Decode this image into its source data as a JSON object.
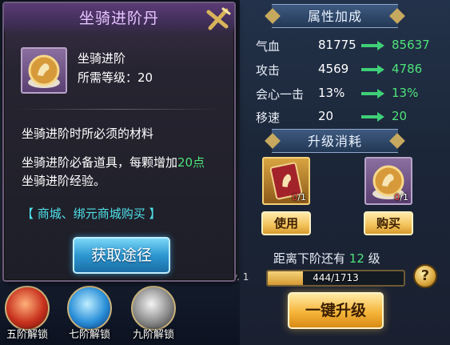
{
  "tooltip": {
    "title": "坐骑进阶丹",
    "item_name": "坐骑进阶",
    "level_req": "所需等级：20",
    "desc_line1": "坐骑进阶时所必须的材料",
    "desc_line2_pre": "坐骑进阶必备道具，每颗增加",
    "desc_line2_hl": "20点",
    "desc_line3": "坐骑进阶经验。",
    "source_links": "【 商城、绑元商城购买 】",
    "get_button": "获取途径"
  },
  "attributes": {
    "header": "属性加成",
    "rows": [
      {
        "name": "气血",
        "current": "81775",
        "next": "85637"
      },
      {
        "name": "攻击",
        "current": "4569",
        "next": "4786"
      },
      {
        "name": "会心一击",
        "current": "13%",
        "next": "13%"
      },
      {
        "name": "移速",
        "current": "20",
        "next": "20"
      }
    ]
  },
  "cost": {
    "header": "升级消耗",
    "items": [
      {
        "have": "0",
        "need": "1",
        "button": "使用"
      },
      {
        "have": "0",
        "need": "1",
        "button": "购买"
      }
    ]
  },
  "progress": {
    "prefix": "距离下阶还有",
    "remaining": "12",
    "suffix": "级",
    "level_tag": "v. 1",
    "exp_text": "444/1713",
    "exp_current": 444,
    "exp_max": 1713
  },
  "upgrade_button": "一键升级",
  "help": "?",
  "unlocks": [
    "五阶解锁",
    "七阶解锁",
    "九阶解锁"
  ],
  "colors": {
    "accent_green": "#4ee37a",
    "cyan_link": "#4ee0e8",
    "shortage_red": "#ff4a4a",
    "gold_button": "#f5b53a"
  }
}
